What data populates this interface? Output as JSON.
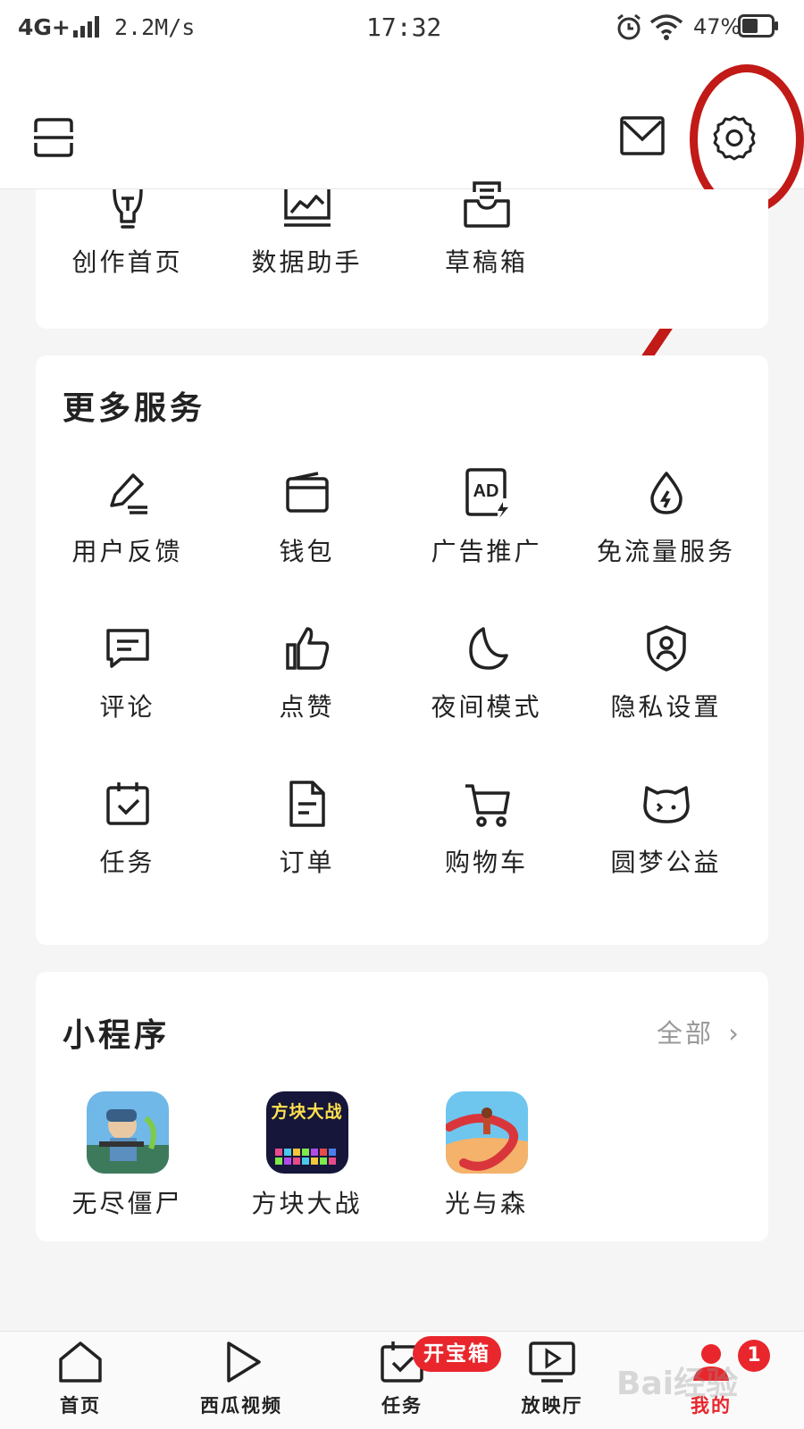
{
  "status_bar": {
    "network": "4G+",
    "speed": "2.2M/s",
    "time": "17:32",
    "battery_percent": "47%",
    "icons": [
      "signal-icon",
      "alarm-icon",
      "wifi-icon",
      "battery-icon"
    ]
  },
  "header": {
    "icons": [
      "scan-icon",
      "mail-icon",
      "settings-gear-icon"
    ],
    "highlight_color": "#c11a17"
  },
  "creator_tools": [
    {
      "label": "创作首页",
      "icon": "lightbulb-icon"
    },
    {
      "label": "数据助手",
      "icon": "chart-icon"
    },
    {
      "label": "草稿箱",
      "icon": "drafts-box-icon"
    }
  ],
  "services": {
    "title": "更多服务",
    "items": [
      {
        "label": "用户反馈",
        "icon": "pen-icon"
      },
      {
        "label": "钱包",
        "icon": "wallet-icon"
      },
      {
        "label": "广告推广",
        "icon": "ad-icon"
      },
      {
        "label": "免流量服务",
        "icon": "data-drop-icon"
      },
      {
        "label": "评论",
        "icon": "comment-icon"
      },
      {
        "label": "点赞",
        "icon": "thumbs-up-icon"
      },
      {
        "label": "夜间模式",
        "icon": "moon-icon"
      },
      {
        "label": "隐私设置",
        "icon": "privacy-shield-icon"
      },
      {
        "label": "任务",
        "icon": "task-calendar-icon"
      },
      {
        "label": "订单",
        "icon": "order-document-icon"
      },
      {
        "label": "购物车",
        "icon": "cart-icon"
      },
      {
        "label": "圆梦公益",
        "icon": "cat-face-icon"
      }
    ]
  },
  "mini_programs": {
    "title": "小程序",
    "see_all": "全部",
    "items": [
      {
        "label": "无尽僵尸"
      },
      {
        "label": "方块大战",
        "icon_text": "方块大战"
      },
      {
        "label": "光与森"
      }
    ]
  },
  "bottom_nav": {
    "items": [
      {
        "label": "首页",
        "icon": "home-icon"
      },
      {
        "label": "西瓜视频",
        "icon": "play-icon"
      },
      {
        "label": "任务",
        "icon": "task-icon"
      },
      {
        "label": "放映厅",
        "icon": "screen-play-icon"
      },
      {
        "label": "我的",
        "icon": "profile-icon"
      }
    ],
    "chest_badge": "开宝箱",
    "notification_count": "1",
    "accent_color": "#e8262c"
  },
  "watermark": "Bai经验"
}
